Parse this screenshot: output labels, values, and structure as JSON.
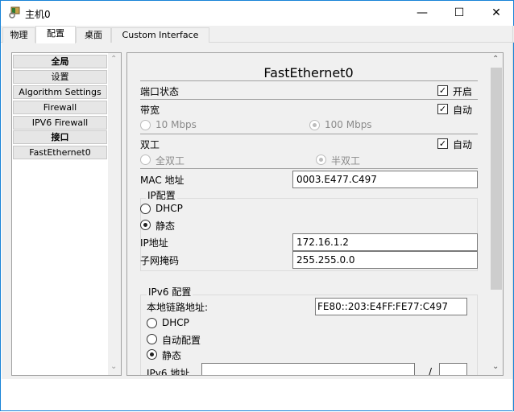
{
  "window": {
    "title": "主机0",
    "icon": "packet-tracer-pc-icon",
    "controls": {
      "minimize": "—",
      "maximize": "☐",
      "close": "✕"
    }
  },
  "tabs": [
    {
      "label": "物理"
    },
    {
      "label": "配置",
      "selected": true
    },
    {
      "label": "桌面"
    },
    {
      "label": "Custom Interface"
    }
  ],
  "sidebar": {
    "items": [
      {
        "label": "全局",
        "header": true
      },
      {
        "label": "设置"
      },
      {
        "label": "Algorithm Settings"
      },
      {
        "label": "Firewall"
      },
      {
        "label": "IPV6 Firewall"
      },
      {
        "label": "接口",
        "header": true
      },
      {
        "label": "FastEthernet0"
      }
    ]
  },
  "panel": {
    "title": "FastEthernet0",
    "port_status": {
      "label": "端口状态",
      "check_label": "开启",
      "checked": true
    },
    "bandwidth": {
      "label": "带宽",
      "check_label": "自动",
      "checked": true,
      "options": [
        "10 Mbps",
        "100 Mbps"
      ],
      "selected": "100 Mbps"
    },
    "duplex": {
      "label": "双工",
      "check_label": "自动",
      "checked": true,
      "options": [
        "全双工",
        "半双工"
      ],
      "selected": "半双工"
    },
    "mac": {
      "label": "MAC 地址",
      "value": "0003.E477.C497"
    },
    "ip_config": {
      "legend": "IP配置",
      "dhcp": "DHCP",
      "static": "静态",
      "mode": "静态",
      "ip_label": "IP地址",
      "ip_value": "172.16.1.2",
      "mask_label": "子网掩码",
      "mask_value": "255.255.0.0"
    },
    "ipv6_config": {
      "legend": "IPv6 配置",
      "link_local_label": "本地链路地址:",
      "link_local_value": "FE80::203:E4FF:FE77:C497",
      "dhcp": "DHCP",
      "auto": "自动配置",
      "static": "静态",
      "mode": "静态",
      "addr_label": "IPv6 地址",
      "addr_value": "",
      "slash": "/",
      "prefix_value": ""
    }
  }
}
